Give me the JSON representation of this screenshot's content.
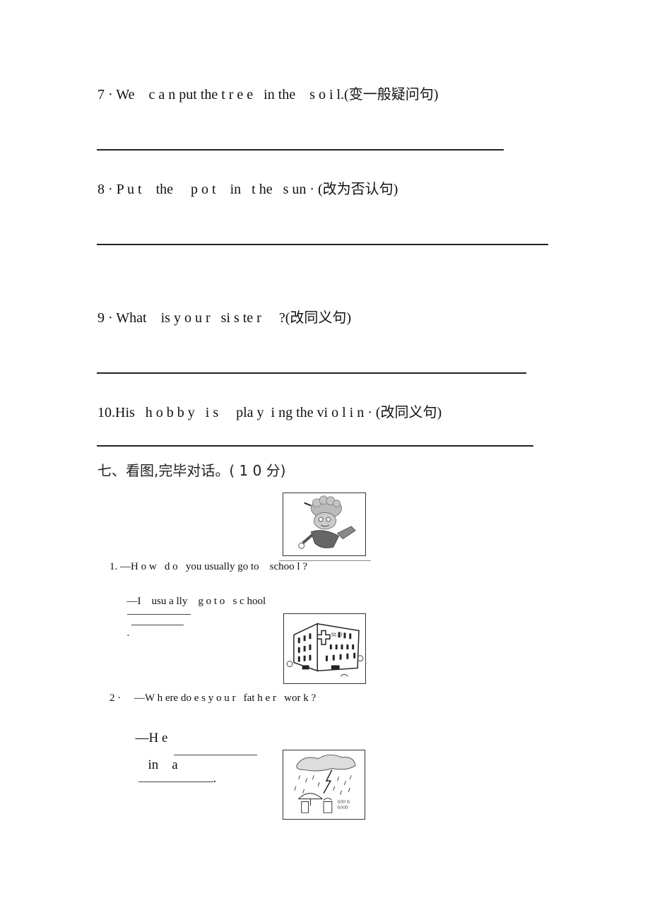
{
  "questions": [
    {
      "number": "7",
      "text": "7 · We    c a n put the t r e e   in the    s o i l.(变一般疑问句)"
    },
    {
      "number": "8",
      "text": "8 · P u t    the     p o t    in   t he   s un · (改为否认句)"
    },
    {
      "number": "9",
      "text": "9 · What    is y o u r   si s te r     ?(改同义句)"
    },
    {
      "number": "10",
      "text": "10.His   h o b b y   i s     pla y  i ng the vi o l i n · (改同义句)"
    }
  ],
  "section": {
    "heading": "七、看图,完毕对话。( 1 0 分)"
  },
  "dialogues": [
    {
      "image": "boy-running-cartoon",
      "question": "1. —H o w   d o   you usually go to    schoo l ?",
      "answer_prefix": "—I    usu a lly    g o t o   s c hool",
      "answer_suffix": "."
    },
    {
      "image": "hospital-building",
      "question": "2 ·     —W h ere do e s y o u r   fat h e r   wor k ?",
      "answer_prefix": "—H e",
      "answer_middle": "in    a",
      "answer_suffix": "."
    },
    {
      "image": "rainy-weather"
    }
  ]
}
